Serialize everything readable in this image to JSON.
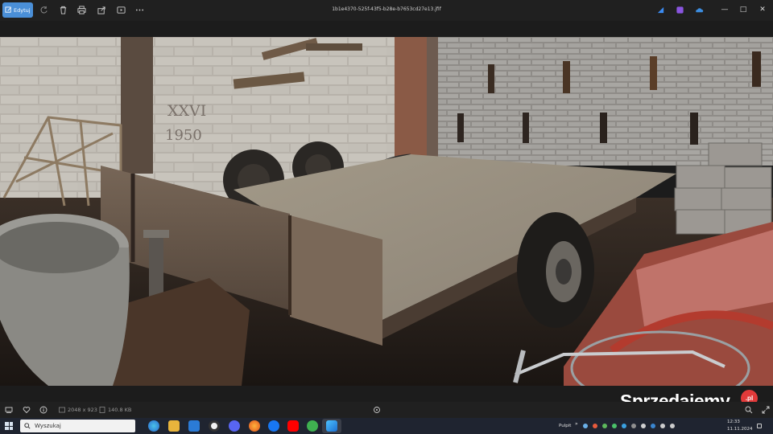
{
  "toolbar": {
    "edit_label": "Edytuj",
    "filename": "1b1e4370-525f-43f5-b28e-b7653cd27e13.jfif",
    "icons": [
      "rotate-icon",
      "delete-icon",
      "print-icon",
      "share-icon",
      "slideshow-icon",
      "more-icon"
    ]
  },
  "window": {
    "minimize": "—",
    "maximize": "□",
    "close": "✕"
  },
  "info": {
    "dimensions": "2048 x 923",
    "size": "140.8 KB"
  },
  "photo": {
    "alt_subject": "flatbed-trailer-in-barn",
    "scratched_text_1": "XXVI",
    "scratched_text_2": "1950"
  },
  "watermark": {
    "brand": "Sprzedajemy",
    "tld": ".pl"
  },
  "taskbar": {
    "search_placeholder": "Wyszukaj",
    "desktop_label": "Pulpit",
    "time": "12:33",
    "date": "11.11.2024"
  },
  "colors": {
    "edit_button": "#4a8fd8",
    "toolbar_bg": "#202020",
    "taskbar_bg": "#1f2430",
    "watermark_dot": "#e23a3a"
  }
}
